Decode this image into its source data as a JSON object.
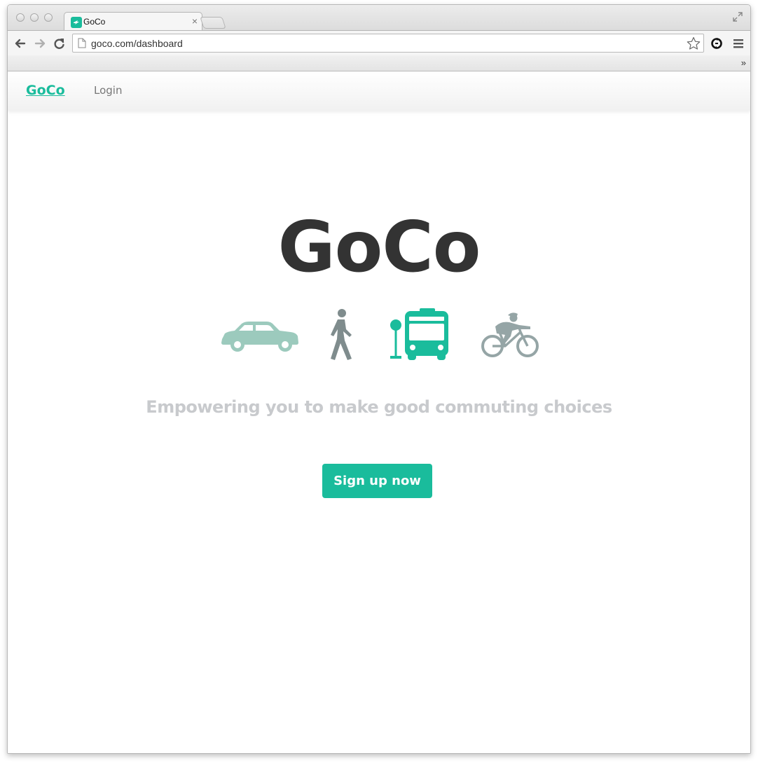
{
  "browser": {
    "tab_title": "GoCo",
    "tab_close": "×",
    "url": "goco.com/dashboard",
    "bookmarks_overflow": "»"
  },
  "site": {
    "brand": "GoCo",
    "nav_login": "Login",
    "hero_title": "GoCo",
    "tagline": "Empowering you to make good commuting choices",
    "cta": "Sign up now"
  },
  "transport_icons": [
    "car-icon",
    "walking-icon",
    "bus-icon",
    "bicycle-icon"
  ],
  "colors": {
    "accent": "#1abc9c",
    "car": "#9ccabd",
    "walker": "#7f8c8d",
    "bus": "#1abc9c",
    "cyclist": "#95a5a6",
    "title": "#333333",
    "tagline": "#c8cacd"
  }
}
